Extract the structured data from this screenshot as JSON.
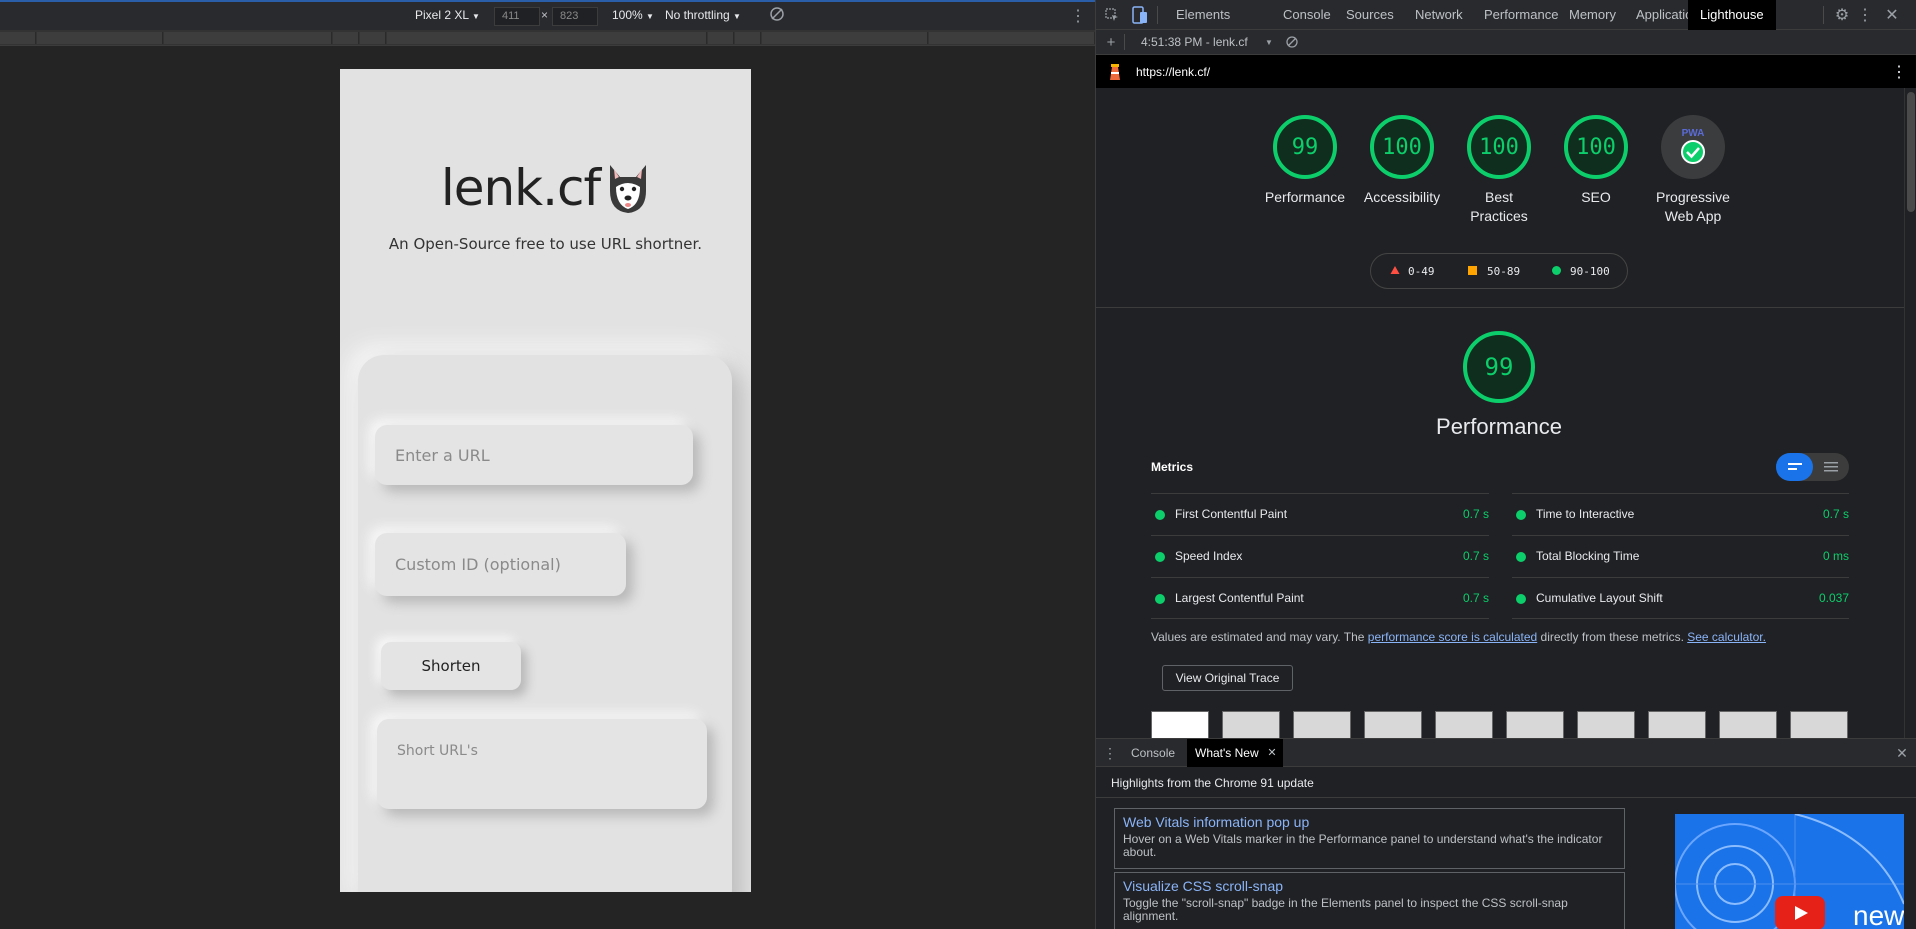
{
  "device_toolbar": {
    "device": "Pixel 2 XL",
    "width": "411",
    "times": "×",
    "height": "823",
    "zoom": "100%",
    "throttling": "No throttling"
  },
  "site": {
    "brand": "lenk.cf",
    "tagline": "An Open-Source free to use URL shortner.",
    "url_placeholder": "Enter a URL",
    "custom_id_placeholder": "Custom ID (optional)",
    "shorten_label": "Shorten",
    "short_urls_label": "Short URL's"
  },
  "devtools": {
    "tabs": [
      "Elements",
      "Console",
      "Sources",
      "Network",
      "Performance",
      "Memory",
      "Application",
      "Lighthouse"
    ],
    "active_tab": "Lighthouse",
    "report_selector": "4:51:38 PM - lenk.cf",
    "report_url": "https://lenk.cf/"
  },
  "scores": [
    {
      "value": "99",
      "label": "Performance"
    },
    {
      "value": "100",
      "label": "Accessibility"
    },
    {
      "value": "100",
      "label": "Best Practices"
    },
    {
      "value": "100",
      "label": "SEO"
    }
  ],
  "pwa": {
    "label": "Progressive Web App",
    "badge_text": "PWA"
  },
  "legend": [
    {
      "range": "0-49",
      "color": "#ff4e42"
    },
    {
      "range": "50-89",
      "color": "#ffa400"
    },
    {
      "range": "90-100",
      "color": "#0cce6b"
    }
  ],
  "performance": {
    "score": "99",
    "title": "Performance",
    "metrics_title": "Metrics",
    "metrics": [
      {
        "name": "First Contentful Paint",
        "value": "0.7 s"
      },
      {
        "name": "Time to Interactive",
        "value": "0.7 s"
      },
      {
        "name": "Speed Index",
        "value": "0.7 s"
      },
      {
        "name": "Total Blocking Time",
        "value": "0 ms"
      },
      {
        "name": "Largest Contentful Paint",
        "value": "0.7 s"
      },
      {
        "name": "Cumulative Layout Shift",
        "value": "0.037"
      }
    ],
    "note_prefix": "Values are estimated and may vary. The ",
    "note_link1": "performance score is calculated",
    "note_mid": " directly from these metrics. ",
    "note_link2": "See calculator.",
    "view_trace": "View Original Trace"
  },
  "drawer": {
    "tabs": [
      "Console",
      "What's New"
    ],
    "active_tab": "What's New",
    "headline": "Highlights from the Chrome 91 update",
    "items": [
      {
        "title": "Web Vitals information pop up",
        "desc": "Hover on a Web Vitals marker in the Performance panel to understand what's the indicator about."
      },
      {
        "title": "Visualize CSS scroll-snap",
        "desc": "Toggle the \"scroll-snap\" badge in the Elements panel to inspect the CSS scroll-snap alignment."
      }
    ],
    "video_text": "new"
  },
  "colors": {
    "pass": "#0cce6b",
    "accent": "#1a73e8",
    "link": "#8ab4f8"
  }
}
